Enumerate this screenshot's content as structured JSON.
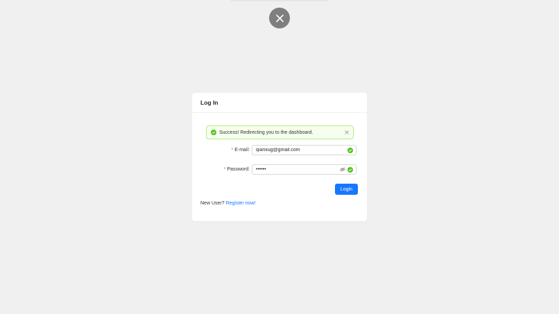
{
  "colors": {
    "background": "#f0f0f0",
    "primary": "#1677ff",
    "success": "#52c41a",
    "required": "#ff4d4f",
    "close_button": "#7f7f7f"
  },
  "overlay": {
    "close_icon": "close-icon"
  },
  "card": {
    "title": "Log In"
  },
  "alert": {
    "type": "success",
    "icon": "check-circle-icon",
    "message": "Success! Redirecting you to the dashboard.",
    "close_glyph": "×"
  },
  "form": {
    "email": {
      "required_mark": "*",
      "label": "E-mail",
      "colon": ":",
      "value": "qianxug@gmail.com",
      "status_icon": "check-circle-icon"
    },
    "password": {
      "required_mark": "*",
      "label": "Password",
      "colon": ":",
      "value": "••••••",
      "visibility_icon": "eye-invisible-icon",
      "status_icon": "check-circle-icon"
    },
    "submit_label": "Login"
  },
  "footer": {
    "prompt": "New User?",
    "link_label": "Register now!"
  }
}
